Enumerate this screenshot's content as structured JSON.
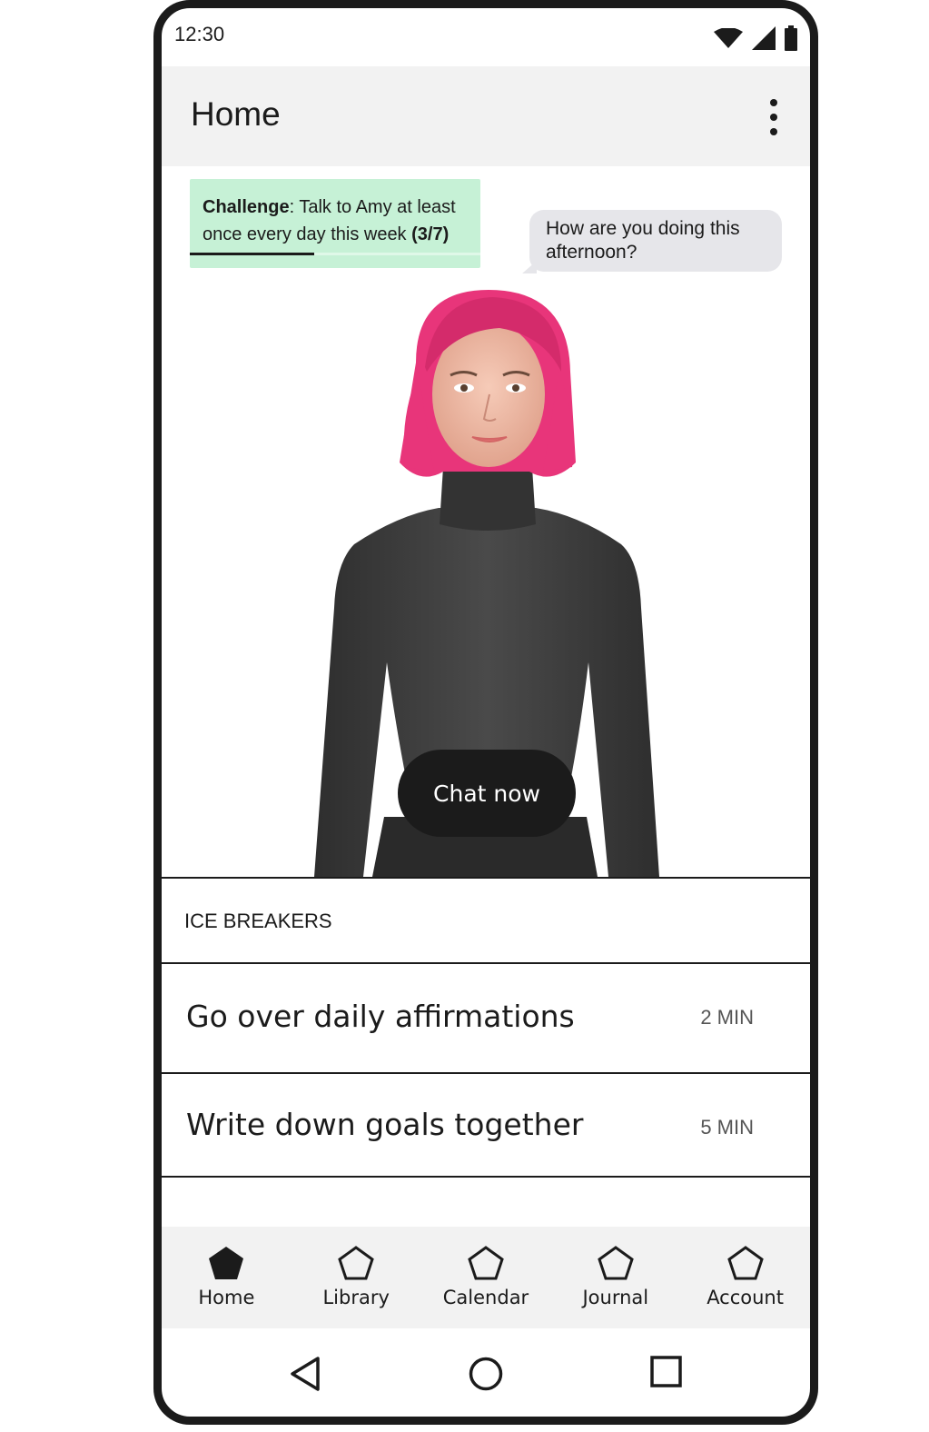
{
  "status_bar": {
    "time": "12:30"
  },
  "app_bar": {
    "title": "Home"
  },
  "challenge": {
    "label": "Challenge",
    "text_part1": ": Talk to Amy at least",
    "text_part2": "once every day this week ",
    "progress_text": "(3/7)",
    "progress_fraction": 0.4286
  },
  "speech_bubble": {
    "line1": "How are you doing this",
    "line2": "afternoon?"
  },
  "chat_button": {
    "label": "Chat now"
  },
  "ice_breakers": {
    "header": "ICE BREAKERS",
    "items": [
      {
        "label": "Go over daily affirmations",
        "duration": "2 MIN"
      },
      {
        "label": "Write down goals together",
        "duration": "5 MIN"
      }
    ]
  },
  "bottom_nav": {
    "items": [
      {
        "label": "Home",
        "icon": "pentagon-filled-icon",
        "active": true
      },
      {
        "label": "Library",
        "icon": "pentagon-outline-icon",
        "active": false
      },
      {
        "label": "Calendar",
        "icon": "pentagon-outline-icon",
        "active": false
      },
      {
        "label": "Journal",
        "icon": "pentagon-outline-icon",
        "active": false
      },
      {
        "label": "Account",
        "icon": "pentagon-outline-icon",
        "active": false
      }
    ]
  },
  "colors": {
    "challenge_bg": "#c6f1d6",
    "bubble_bg": "#e6e6ea",
    "appbar_bg": "#f2f2f2",
    "button_bg": "#1b1b1b",
    "avatar_hair": "#e8357a",
    "avatar_sweater": "#3a3a3a"
  }
}
